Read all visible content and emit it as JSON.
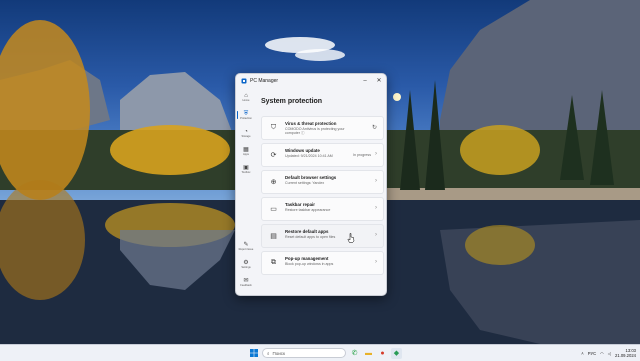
{
  "window": {
    "title": "PC Manager",
    "minimize": "–",
    "close": "✕"
  },
  "nav": {
    "items": [
      {
        "label": "Home",
        "icon": "home-icon"
      },
      {
        "label": "Protection",
        "icon": "shield-icon",
        "active": true
      },
      {
        "label": "Storage",
        "icon": "storage-icon"
      },
      {
        "label": "Apps",
        "icon": "apps-icon"
      },
      {
        "label": "Toolbox",
        "icon": "toolbox-icon"
      }
    ],
    "bottom": [
      {
        "label": "Report Issue",
        "icon": "broom-icon"
      },
      {
        "label": "Settings",
        "icon": "gear-icon"
      },
      {
        "label": "Feedback",
        "icon": "feedback-icon"
      }
    ]
  },
  "page": {
    "title": "System protection",
    "cards": [
      {
        "title": "Virus & threat protection",
        "sub": "COMODO Antivirus is protecting your computer ⓘ",
        "icon": "shield-outline-icon",
        "status": "",
        "action": "refresh"
      },
      {
        "title": "Windows update",
        "sub": "Updated: 9/21/2024 10:41 AM",
        "icon": "sync-icon",
        "status": "In progress",
        "action": "chevron"
      },
      {
        "title": "Default browser settings",
        "sub": "Current settings: Yandex",
        "icon": "globe-icon",
        "status": "",
        "action": "chevron"
      },
      {
        "title": "Taskbar repair",
        "sub": "Restore taskbar appearance",
        "icon": "taskbar-icon",
        "status": "",
        "action": "chevron"
      },
      {
        "title": "Restore default apps",
        "sub": "Reset default apps to open files",
        "icon": "default-apps-icon",
        "status": "",
        "action": "chevron"
      },
      {
        "title": "Pop-up management",
        "sub": "Block pop-up windows in apps",
        "icon": "popup-icon",
        "status": "",
        "action": "chevron"
      }
    ]
  },
  "taskbar": {
    "search_placeholder": "Поиск",
    "lang": "РУС",
    "time": "13:03",
    "date": "21.09.2024"
  },
  "colors": {
    "accent": "#0a64c8",
    "window_bg": "#f3f4f8",
    "taskbar_bg": "#eef1f7"
  }
}
